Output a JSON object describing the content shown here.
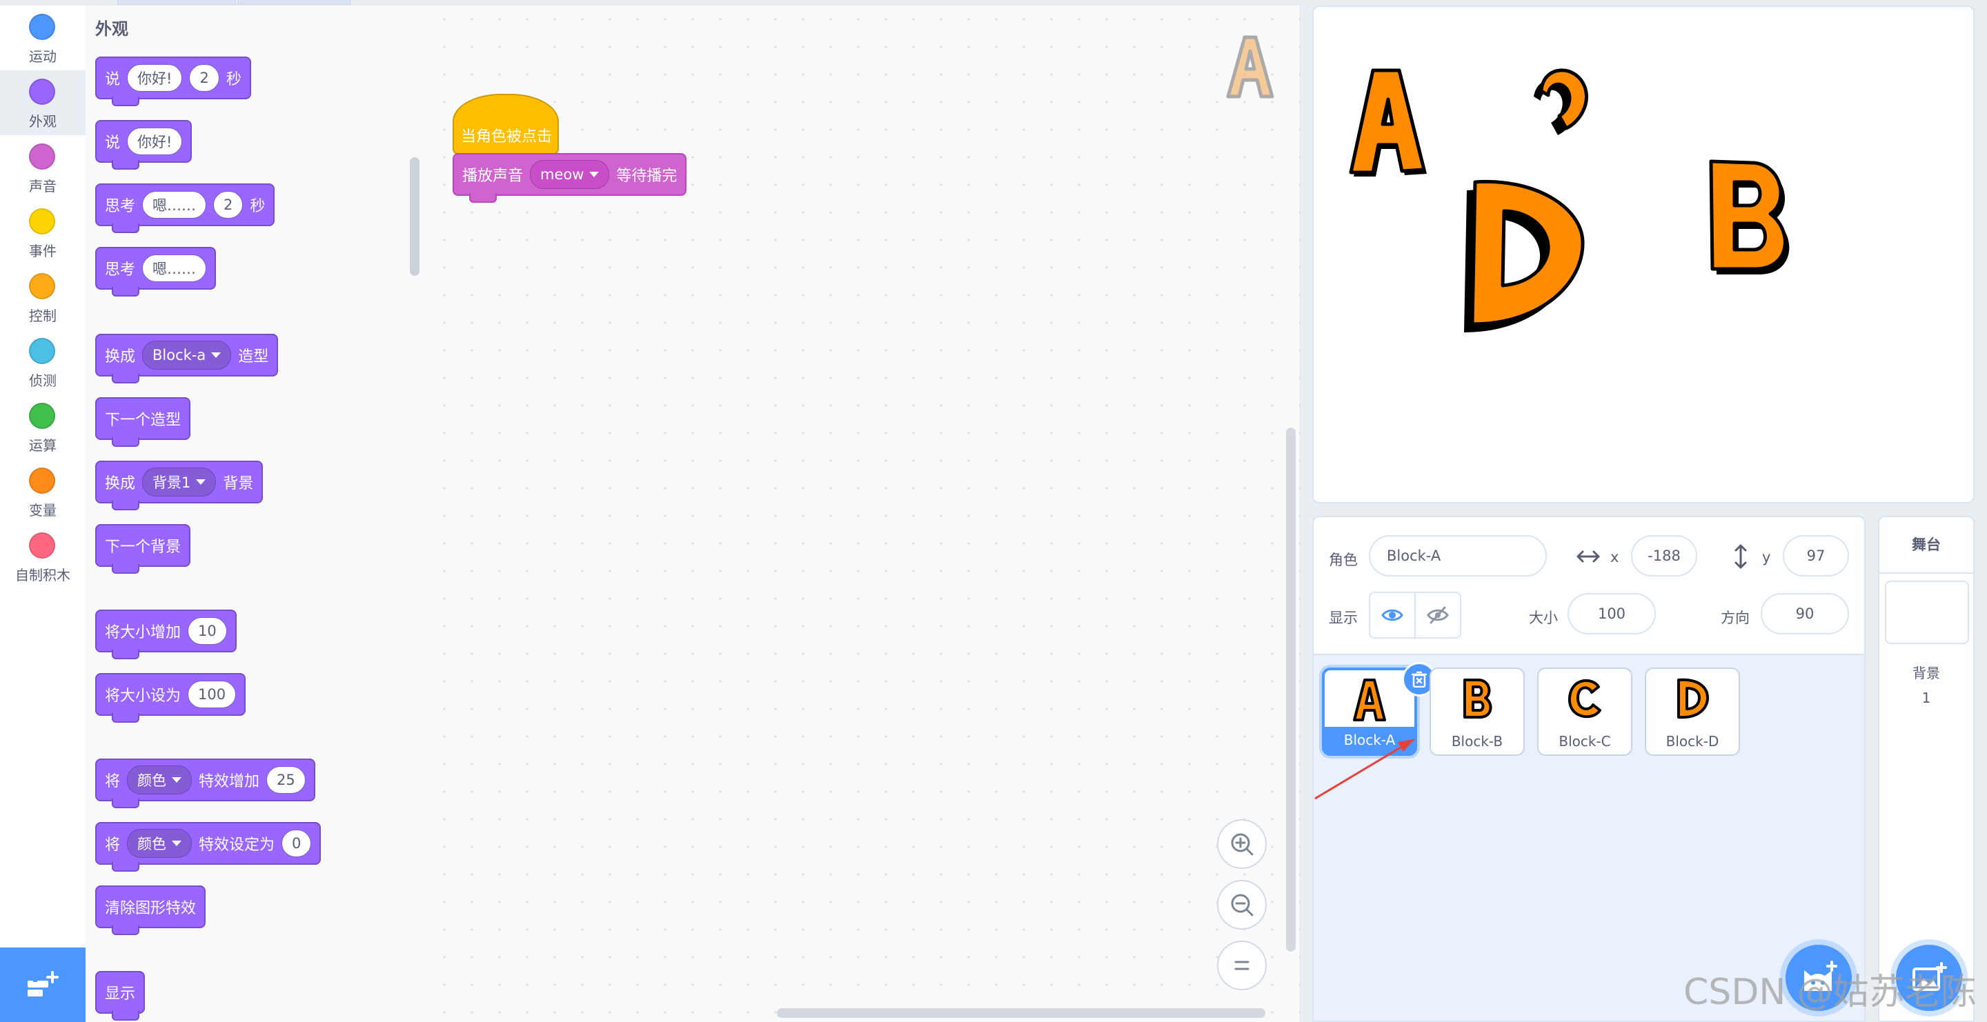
{
  "categories": [
    {
      "label": "运动",
      "color": "#4c97ff"
    },
    {
      "label": "外观",
      "color": "#9966ff"
    },
    {
      "label": "声音",
      "color": "#cf63cf"
    },
    {
      "label": "事件",
      "color": "#ffd500"
    },
    {
      "label": "控制",
      "color": "#ffab19"
    },
    {
      "label": "侦测",
      "color": "#4cbfe6"
    },
    {
      "label": "运算",
      "color": "#40bf4a"
    },
    {
      "label": "变量",
      "color": "#ff8c1a"
    },
    {
      "label": "自制积木",
      "color": "#ff6680"
    }
  ],
  "active_category": "外观",
  "palette": {
    "title": "外观",
    "say_secs": {
      "label": "说",
      "text": "你好!",
      "secs": "2",
      "unit": "秒"
    },
    "say": {
      "label": "说",
      "text": "你好!"
    },
    "think_secs": {
      "label": "思考",
      "text": "嗯……",
      "secs": "2",
      "unit": "秒"
    },
    "think": {
      "label": "思考",
      "text": "嗯……"
    },
    "switch_costume": {
      "label": "换成",
      "value": "Block-a",
      "suffix": "造型"
    },
    "next_costume": {
      "label": "下一个造型"
    },
    "switch_backdrop": {
      "label": "换成",
      "value": "背景1",
      "suffix": "背景"
    },
    "next_backdrop": {
      "label": "下一个背景"
    },
    "change_size": {
      "label": "将大小增加",
      "value": "10"
    },
    "set_size": {
      "label": "将大小设为",
      "value": "100"
    },
    "change_effect": {
      "label": "将",
      "effect": "颜色",
      "middle": "特效增加",
      "value": "25"
    },
    "set_effect": {
      "label": "将",
      "effect": "颜色",
      "middle": "特效设定为",
      "value": "0"
    },
    "clear_effects": {
      "label": "清除图形特效"
    },
    "show": {
      "label": "显示"
    }
  },
  "script": {
    "hat": "当角色被点击",
    "play_sound": {
      "label": "播放声音",
      "sound": "meow",
      "suffix": "等待播完"
    }
  },
  "sprite_info": {
    "sprite_label": "角色",
    "sprite_name": "Block-A",
    "x_label": "x",
    "x_value": "-188",
    "y_label": "y",
    "y_value": "97",
    "show_label": "显示",
    "size_label": "大小",
    "size_value": "100",
    "direction_label": "方向",
    "direction_value": "90"
  },
  "sprites": [
    {
      "name": "Block-A",
      "letter": "A",
      "selected": true
    },
    {
      "name": "Block-B",
      "letter": "B",
      "selected": false
    },
    {
      "name": "Block-C",
      "letter": "C",
      "selected": false
    },
    {
      "name": "Block-D",
      "letter": "D",
      "selected": false
    }
  ],
  "stage_panel": {
    "title": "舞台",
    "backdrops_label": "背景",
    "backdrops_count": "1"
  },
  "watermark": "CSDN @姑苏老陈",
  "colors": {
    "looks": "#9966ff",
    "sound": "#cf63cf",
    "event": "#ffbf00",
    "accent": "#4c97ff",
    "letter_fill": "#ff8c00"
  }
}
